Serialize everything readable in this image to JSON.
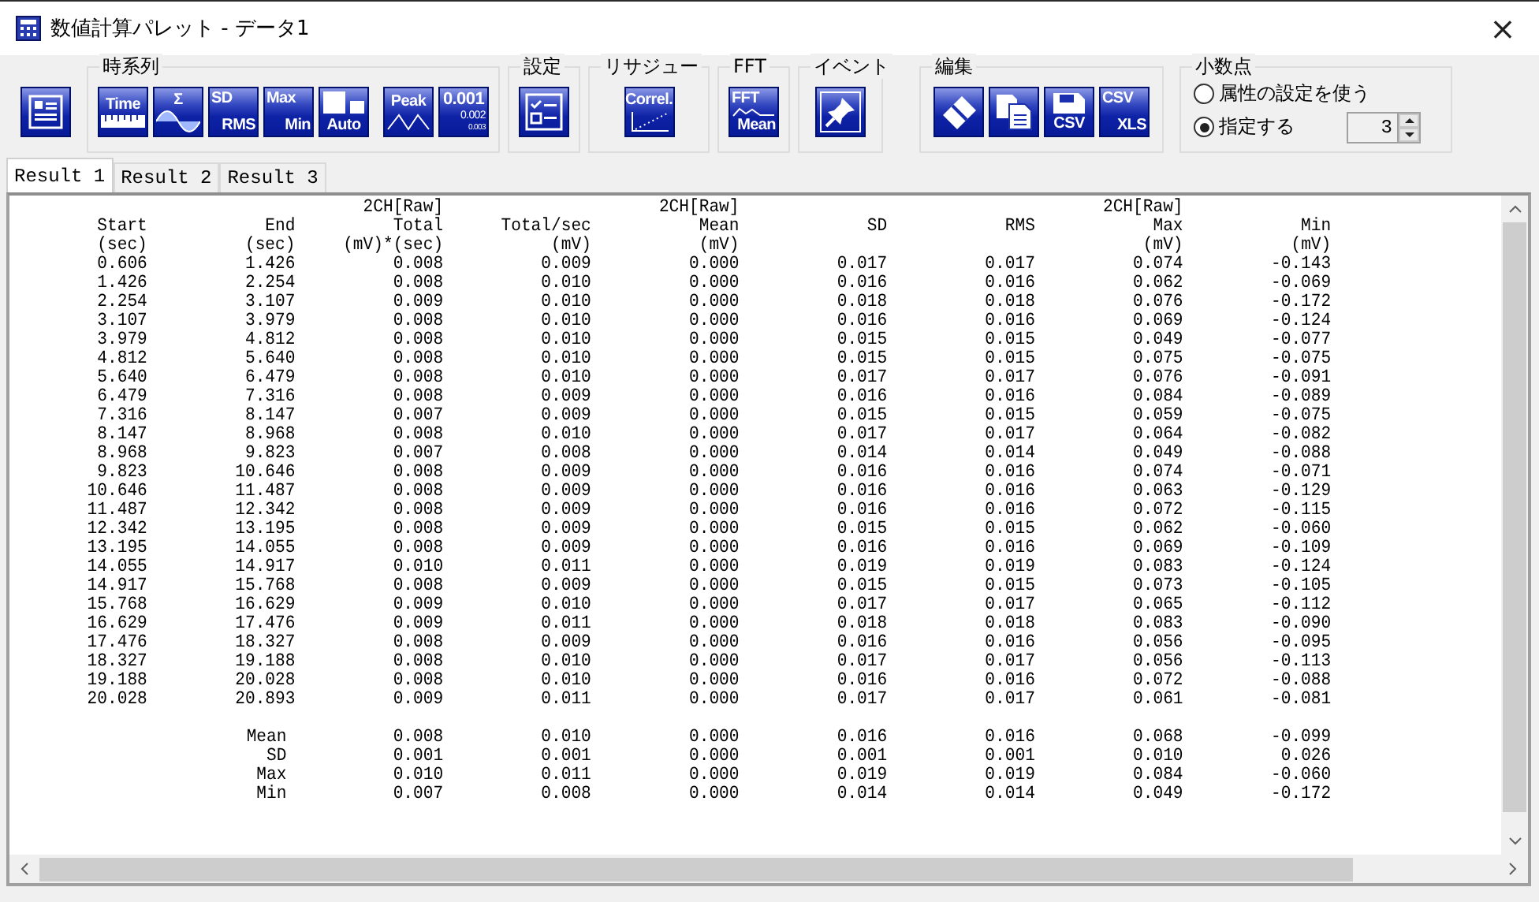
{
  "window": {
    "title": "数値計算パレット - データ1",
    "close": "×"
  },
  "toolbar": {
    "groups": [
      {
        "clusters": [
          [
            {
              "kind": "report"
            }
          ]
        ]
      },
      {
        "label": "時系列",
        "clusters": [
          [
            {
              "kind": "time",
              "texts": [
                "Time"
              ]
            },
            {
              "kind": "sigma",
              "texts": [
                "Σ"
              ]
            },
            {
              "kind": "sdrms",
              "texts": [
                "SD",
                "RMS"
              ]
            },
            {
              "kind": "maxmin",
              "texts": [
                "Max",
                "Min"
              ]
            },
            {
              "kind": "auto",
              "texts": [
                "Auto"
              ]
            }
          ],
          [
            {
              "kind": "peak",
              "texts": [
                "Peak"
              ]
            },
            {
              "kind": "decimals",
              "texts": [
                "0.001",
                "0.002",
                "0.003"
              ]
            }
          ]
        ]
      },
      {
        "label": "設定",
        "clusters": [
          [
            {
              "kind": "settings"
            }
          ]
        ]
      },
      {
        "label": "リサジュー",
        "clusters": [
          [
            {
              "kind": "correl",
              "texts": [
                "Correl."
              ]
            }
          ]
        ]
      },
      {
        "label": "FFT",
        "clusters": [
          [
            {
              "kind": "fft",
              "texts": [
                "FFT",
                "Mean"
              ]
            }
          ]
        ]
      },
      {
        "label": "イベント",
        "clusters": [
          [
            {
              "kind": "event"
            }
          ]
        ]
      },
      {
        "label": "編集",
        "clusters": [
          [
            {
              "kind": "eraser"
            },
            {
              "kind": "copy"
            },
            {
              "kind": "savecsv",
              "texts": [
                "CSV"
              ]
            },
            {
              "kind": "csvxls",
              "texts": [
                "CSV",
                "XLS"
              ]
            }
          ]
        ]
      }
    ]
  },
  "decimal_point": {
    "label": "小数点",
    "options": [
      {
        "label": "属性の設定を使う",
        "selected": false
      },
      {
        "label": "指定する",
        "selected": true
      }
    ],
    "value": "3"
  },
  "tabs": [
    {
      "label": "Result 1",
      "selected": true
    },
    {
      "label": "Result 2",
      "selected": false
    },
    {
      "label": "Result 3",
      "selected": false
    }
  ],
  "table": {
    "columns": [
      {
        "name": "Start",
        "unit": "(sec)"
      },
      {
        "name": "End",
        "unit": "(sec)"
      },
      {
        "group": "2CH[Raw]",
        "name": "Total",
        "unit": "(mV)*(sec)"
      },
      {
        "name": "Total/sec",
        "unit": "(mV)"
      },
      {
        "group": "2CH[Raw]",
        "name": "Mean",
        "unit": "(mV)"
      },
      {
        "name": "SD"
      },
      {
        "name": "RMS"
      },
      {
        "group": "2CH[Raw]",
        "name": "Max",
        "unit": "(mV)"
      },
      {
        "name": "Min",
        "unit": "(mV)"
      }
    ],
    "rows": [
      [
        "0.606",
        "1.426",
        "0.008",
        "0.009",
        "0.000",
        "0.017",
        "0.017",
        "0.074",
        "-0.143"
      ],
      [
        "1.426",
        "2.254",
        "0.008",
        "0.010",
        "0.000",
        "0.016",
        "0.016",
        "0.062",
        "-0.069"
      ],
      [
        "2.254",
        "3.107",
        "0.009",
        "0.010",
        "0.000",
        "0.018",
        "0.018",
        "0.076",
        "-0.172"
      ],
      [
        "3.107",
        "3.979",
        "0.008",
        "0.010",
        "0.000",
        "0.016",
        "0.016",
        "0.069",
        "-0.124"
      ],
      [
        "3.979",
        "4.812",
        "0.008",
        "0.010",
        "0.000",
        "0.015",
        "0.015",
        "0.049",
        "-0.077"
      ],
      [
        "4.812",
        "5.640",
        "0.008",
        "0.010",
        "0.000",
        "0.015",
        "0.015",
        "0.075",
        "-0.075"
      ],
      [
        "5.640",
        "6.479",
        "0.008",
        "0.010",
        "0.000",
        "0.017",
        "0.017",
        "0.076",
        "-0.091"
      ],
      [
        "6.479",
        "7.316",
        "0.008",
        "0.009",
        "0.000",
        "0.016",
        "0.016",
        "0.084",
        "-0.089"
      ],
      [
        "7.316",
        "8.147",
        "0.007",
        "0.009",
        "0.000",
        "0.015",
        "0.015",
        "0.059",
        "-0.075"
      ],
      [
        "8.147",
        "8.968",
        "0.008",
        "0.010",
        "0.000",
        "0.017",
        "0.017",
        "0.064",
        "-0.082"
      ],
      [
        "8.968",
        "9.823",
        "0.007",
        "0.008",
        "0.000",
        "0.014",
        "0.014",
        "0.049",
        "-0.088"
      ],
      [
        "9.823",
        "10.646",
        "0.008",
        "0.009",
        "0.000",
        "0.016",
        "0.016",
        "0.074",
        "-0.071"
      ],
      [
        "10.646",
        "11.487",
        "0.008",
        "0.009",
        "0.000",
        "0.016",
        "0.016",
        "0.063",
        "-0.129"
      ],
      [
        "11.487",
        "12.342",
        "0.008",
        "0.009",
        "0.000",
        "0.016",
        "0.016",
        "0.072",
        "-0.115"
      ],
      [
        "12.342",
        "13.195",
        "0.008",
        "0.009",
        "0.000",
        "0.015",
        "0.015",
        "0.062",
        "-0.060"
      ],
      [
        "13.195",
        "14.055",
        "0.008",
        "0.009",
        "0.000",
        "0.016",
        "0.016",
        "0.069",
        "-0.109"
      ],
      [
        "14.055",
        "14.917",
        "0.010",
        "0.011",
        "0.000",
        "0.019",
        "0.019",
        "0.083",
        "-0.124"
      ],
      [
        "14.917",
        "15.768",
        "0.008",
        "0.009",
        "0.000",
        "0.015",
        "0.015",
        "0.073",
        "-0.105"
      ],
      [
        "15.768",
        "16.629",
        "0.009",
        "0.010",
        "0.000",
        "0.017",
        "0.017",
        "0.065",
        "-0.112"
      ],
      [
        "16.629",
        "17.476",
        "0.009",
        "0.011",
        "0.000",
        "0.018",
        "0.018",
        "0.083",
        "-0.090"
      ],
      [
        "17.476",
        "18.327",
        "0.008",
        "0.009",
        "0.000",
        "0.016",
        "0.016",
        "0.056",
        "-0.095"
      ],
      [
        "18.327",
        "19.188",
        "0.008",
        "0.010",
        "0.000",
        "0.017",
        "0.017",
        "0.056",
        "-0.113"
      ],
      [
        "19.188",
        "20.028",
        "0.008",
        "0.010",
        "0.000",
        "0.016",
        "0.016",
        "0.072",
        "-0.088"
      ],
      [
        "20.028",
        "20.893",
        "0.009",
        "0.011",
        "0.000",
        "0.017",
        "0.017",
        "0.061",
        "-0.081"
      ]
    ],
    "summary": [
      {
        "label": "Mean",
        "values": [
          "0.008",
          "0.010",
          "0.000",
          "0.016",
          "0.016",
          "0.068",
          "-0.099"
        ]
      },
      {
        "label": "SD",
        "values": [
          "0.001",
          "0.001",
          "0.000",
          "0.001",
          "0.001",
          "0.010",
          "0.026"
        ]
      },
      {
        "label": "Max",
        "values": [
          "0.010",
          "0.011",
          "0.000",
          "0.019",
          "0.019",
          "0.084",
          "-0.060"
        ]
      },
      {
        "label": "Min",
        "values": [
          "0.007",
          "0.008",
          "0.000",
          "0.014",
          "0.014",
          "0.049",
          "-0.172"
        ]
      }
    ]
  }
}
